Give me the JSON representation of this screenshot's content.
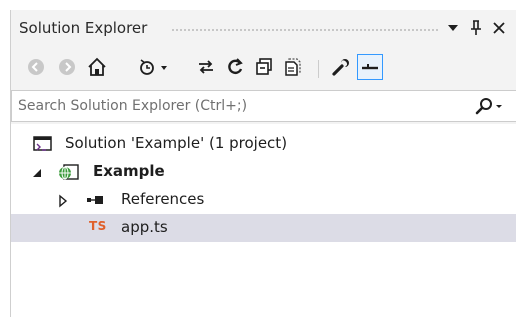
{
  "window": {
    "title": "Solution Explorer",
    "dropdown_glyph": "▾",
    "pin_glyph": "⊥",
    "close_glyph": "✕"
  },
  "toolbar": {
    "items": [
      {
        "name": "back",
        "icon": "back-arrow-icon"
      },
      {
        "name": "forward",
        "icon": "forward-arrow-icon"
      },
      {
        "name": "home",
        "icon": "home-icon"
      },
      {
        "name": "pending-changes-filter",
        "icon": "pending-changes-filter-icon"
      },
      {
        "name": "sync-with-active-document",
        "icon": "sync-arrows-icon"
      },
      {
        "name": "refresh",
        "icon": "refresh-icon"
      },
      {
        "name": "collapse-all",
        "icon": "collapse-all-icon"
      },
      {
        "name": "show-all-files",
        "icon": "show-all-files-icon"
      },
      {
        "name": "properties",
        "icon": "wrench-icon"
      },
      {
        "name": "preview-selected-items",
        "icon": "preview-selected-items-icon",
        "active": true
      }
    ]
  },
  "search": {
    "placeholder": "Search Solution Explorer (Ctrl+;)",
    "value": ""
  },
  "tree": {
    "items": [
      {
        "label": "Solution 'Example' (1 project)",
        "icon": "solution-icon",
        "level": 0,
        "expander": "none"
      },
      {
        "label": "Example",
        "icon": "web-project-icon",
        "level": 1,
        "expander": "expanded",
        "bold": true
      },
      {
        "label": "References",
        "icon": "references-icon",
        "level": 2,
        "expander": "collapsed"
      },
      {
        "label": "app.ts",
        "icon": "typescript-file-icon",
        "icon_text": "TS",
        "level": 2,
        "expander": "none",
        "selected": true
      }
    ]
  },
  "colors": {
    "panel_bg": "#f3f3f3",
    "selected_row": "#dcdce6",
    "active_tool_border": "#3399ff",
    "typescript_badge": "#e0602a",
    "globe_green": "#3a9a3a"
  }
}
